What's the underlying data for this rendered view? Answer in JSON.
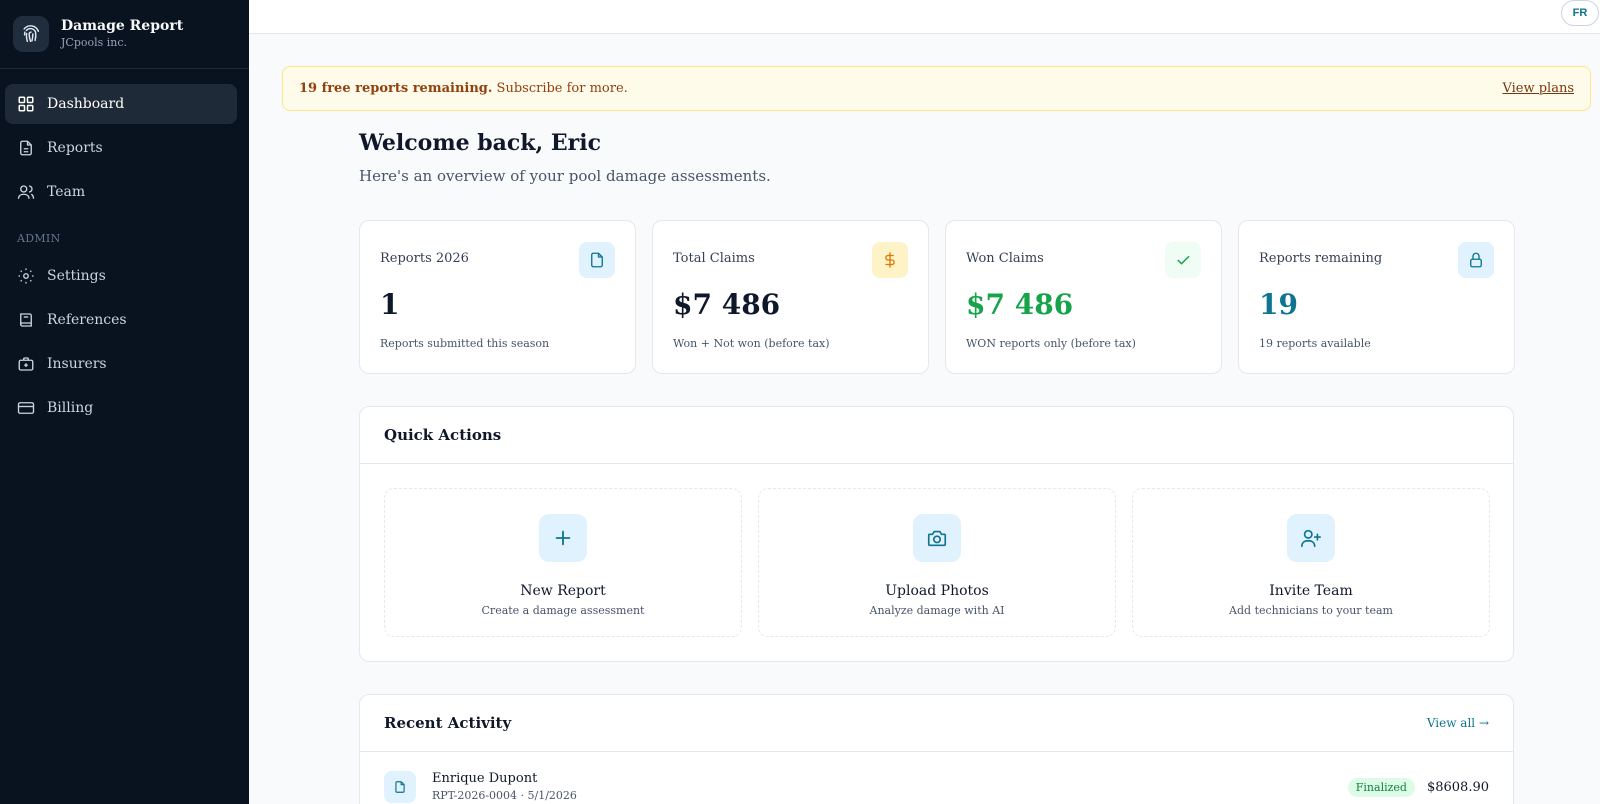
{
  "brand": {
    "title": "Damage Report",
    "company": "JCpools inc."
  },
  "nav": {
    "items": [
      {
        "label": "Dashboard",
        "icon": "grid-icon"
      },
      {
        "label": "Reports",
        "icon": "file-icon"
      },
      {
        "label": "Team",
        "icon": "users-icon"
      }
    ],
    "admin_label": "ADMIN",
    "admin_items": [
      {
        "label": "Settings",
        "icon": "gear-icon"
      },
      {
        "label": "References",
        "icon": "book-icon"
      },
      {
        "label": "Insurers",
        "icon": "briefcase-plus-icon"
      },
      {
        "label": "Billing",
        "icon": "credit-card-icon"
      }
    ]
  },
  "topbar": {
    "lang": "FR"
  },
  "banner": {
    "bold": "19 free reports remaining.",
    "text": "Subscribe for more.",
    "link": "View plans"
  },
  "header": {
    "welcome": "Welcome back, Eric",
    "subtitle": "Here's an overview of your pool damage assessments."
  },
  "stats": [
    {
      "label": "Reports 2026",
      "value": "1",
      "note": "Reports submitted this season",
      "icon": "file-icon",
      "color": "#0f172a"
    },
    {
      "label": "Total Claims",
      "value": "$7 486",
      "note": "Won + Not won (before tax)",
      "icon": "dollar-icon",
      "color": "#0f172a"
    },
    {
      "label": "Won Claims",
      "value": "$7 486",
      "note": "WON reports only (before tax)",
      "icon": "check-icon",
      "color": "#16a34a"
    },
    {
      "label": "Reports remaining",
      "value": "19",
      "note": "19 reports available",
      "icon": "lock-icon",
      "color": "#0e7490"
    }
  ],
  "quick_actions": {
    "title": "Quick Actions",
    "items": [
      {
        "title": "New Report",
        "sub": "Create a damage assessment",
        "icon": "plus-icon"
      },
      {
        "title": "Upload Photos",
        "sub": "Analyze damage with AI",
        "icon": "camera-icon"
      },
      {
        "title": "Invite Team",
        "sub": "Add technicians to your team",
        "icon": "user-plus-icon"
      }
    ]
  },
  "recent": {
    "title": "Recent Activity",
    "view_all": "View all →",
    "items": [
      {
        "name": "Enrique Dupont",
        "meta": "RPT-2026-0004 · 5/1/2026",
        "status": "Finalized",
        "amount": "$8608.90"
      }
    ]
  },
  "colors": {
    "sidebar": "#08131f",
    "accent": "#0e7490",
    "success": "#16a34a",
    "warning_bg": "#fffbeb"
  }
}
